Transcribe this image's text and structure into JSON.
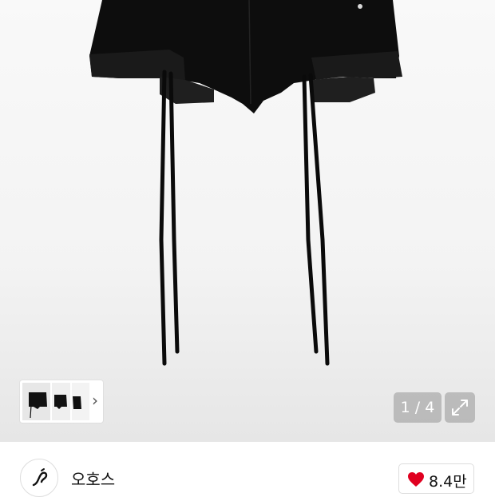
{
  "gallery": {
    "page_counter": "1 / 4",
    "thumbnail_count": 3
  },
  "shop": {
    "name": "오호스"
  },
  "like": {
    "count": "8.4만",
    "heart_color": "#e00020"
  },
  "icons": {
    "expand": "expand-icon",
    "chevron": "chevron-right-icon",
    "heart": "heart-icon"
  }
}
